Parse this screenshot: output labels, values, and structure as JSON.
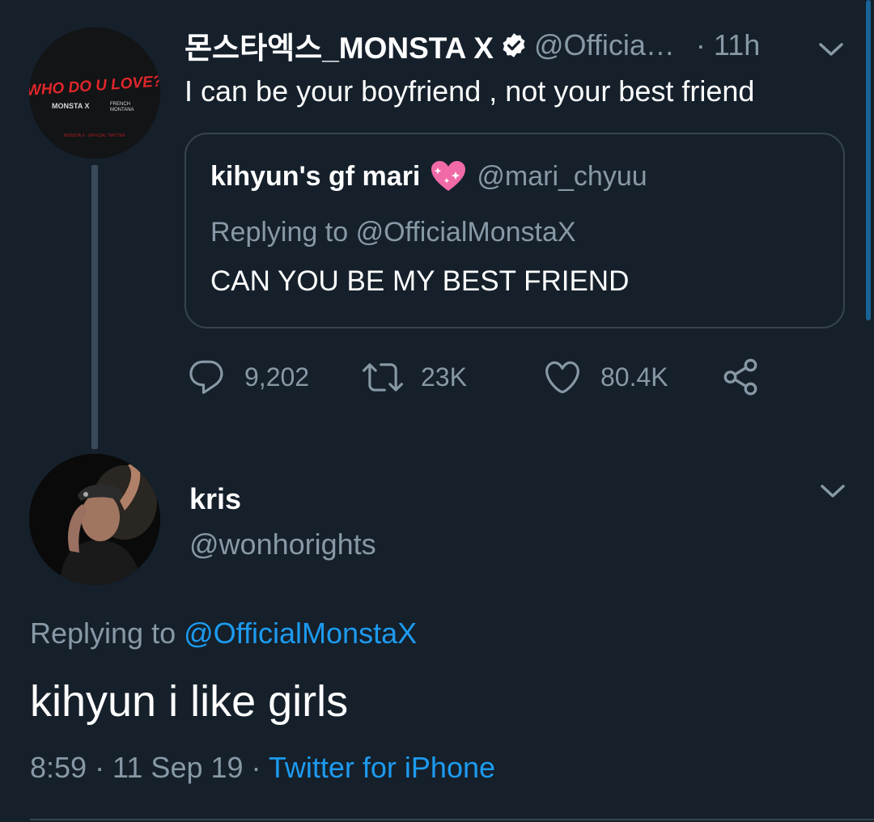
{
  "tweet": {
    "author_name": "몬스타엑스_MONSTA X",
    "author_handle": "@Officia…",
    "time": "· 11h",
    "text": "I can be your boyfriend , not your best friend",
    "avatar_text": {
      "title": "WHO DO U LOVE?",
      "line2_left": "MONSTA X",
      "line2_right_top": "FRENCH",
      "line2_right_bottom": "MONTANA",
      "footer": "MONSTA X · OFFICIAL TWITTER"
    },
    "quote": {
      "name": "kihyun's gf mari",
      "emoji_icon": "sparkling-heart-icon",
      "handle": "@mari_chyuu",
      "replying_prefix": "Replying to",
      "replying_to": "@OfficialMonstaX",
      "text": "CAN YOU BE MY BEST FRIEND"
    },
    "actions": {
      "replies": "9,202",
      "retweets": "23K",
      "likes": "80.4K"
    }
  },
  "reply": {
    "author_name": "kris",
    "author_handle": "@wonhorights",
    "replying_prefix": "Replying to",
    "replying_to": "@OfficialMonstaX",
    "text": "kihyun i like girls",
    "timestamp": "8:59 · 11 Sep 19 ·",
    "source": "Twitter for iPhone"
  },
  "colors": {
    "background": "#15202b",
    "secondary_text": "#8899a6",
    "link": "#1d9bf0",
    "border": "#38444d",
    "brand_red": "#e0262a"
  }
}
